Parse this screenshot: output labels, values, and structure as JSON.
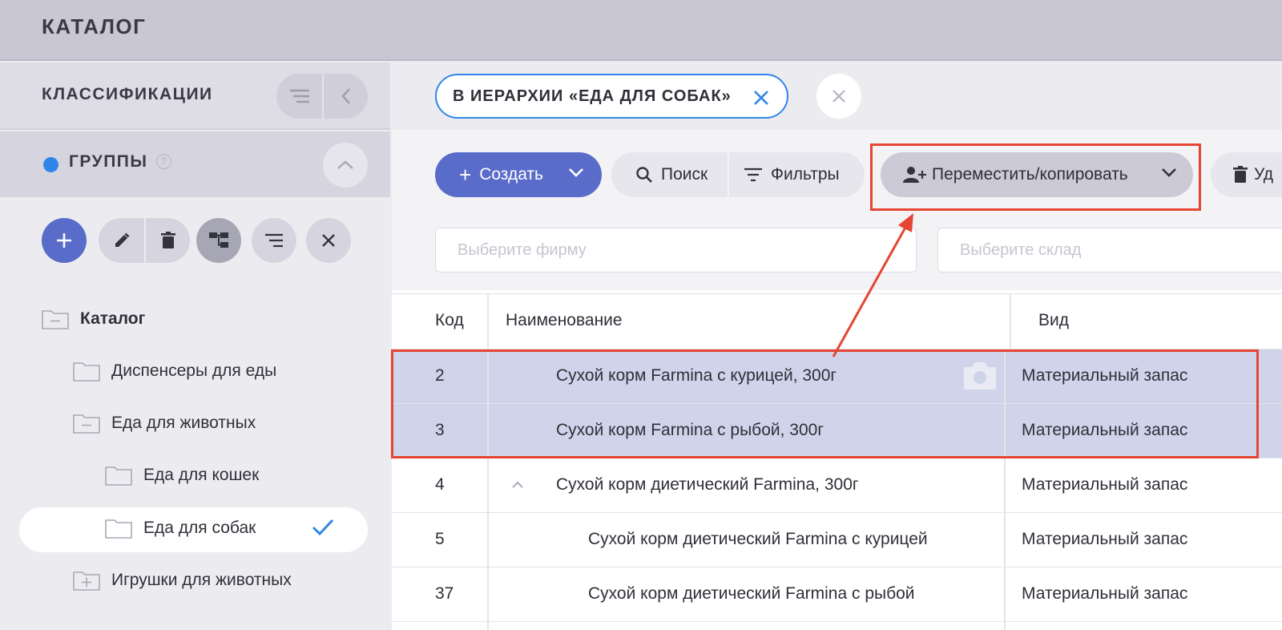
{
  "topbar": {
    "title": "КАТАЛОГ"
  },
  "left": {
    "classifications_title": "КЛАССИФИКАЦИИ",
    "groups_title": "ГРУППЫ",
    "help_mark": "?",
    "tree": [
      {
        "label": "Каталог",
        "level": 0,
        "state": "expanded",
        "bold": true
      },
      {
        "label": "Диспенсеры для еды",
        "level": 1,
        "state": "leaf"
      },
      {
        "label": "Еда для животных",
        "level": 1,
        "state": "expanded"
      },
      {
        "label": "Еда для кошек",
        "level": 2,
        "state": "leaf"
      },
      {
        "label": "Еда для собак",
        "level": 2,
        "state": "leaf",
        "selected": true
      },
      {
        "label": "Игрушки для животных",
        "level": 1,
        "state": "collapsed"
      }
    ]
  },
  "chip": {
    "label": "В ИЕРАРХИИ «ЕДА ДЛЯ СОБАК»"
  },
  "toolbar": {
    "create_label": "Создать",
    "search_label": "Поиск",
    "filters_label": "Фильтры",
    "move_label": "Переместить/копировать",
    "delete_label": "Уд"
  },
  "filters": {
    "company_placeholder": "Выберите фирму",
    "warehouse_placeholder": "Выберите склад"
  },
  "table": {
    "columns": [
      "Код",
      "Наименование",
      "Вид"
    ],
    "rows": [
      {
        "code": "2",
        "name": "Сухой корм Farmina с курицей, 300г",
        "kind": "Материальный запас",
        "selected": true,
        "indent": 1
      },
      {
        "code": "3",
        "name": "Сухой корм Farmina с рыбой, 300г",
        "kind": "Материальный запас",
        "selected": true,
        "indent": 1
      },
      {
        "code": "4",
        "name": "Сухой корм диетический Farmina, 300г",
        "kind": "Материальный запас",
        "selected": false,
        "indent": 1,
        "expanded": true
      },
      {
        "code": "5",
        "name": "Сухой корм диетический Farmina с курицей",
        "kind": "Материальный запас",
        "selected": false,
        "indent": 2
      },
      {
        "code": "37",
        "name": "Сухой корм диетический Farmina с рыбой",
        "kind": "Материальный запас",
        "selected": false,
        "indent": 2
      }
    ]
  },
  "colors": {
    "accent": "#2f86e8",
    "primary_button": "#5a6cc9",
    "annotation": "#e64533",
    "selected_row": "#d0d4ea"
  }
}
